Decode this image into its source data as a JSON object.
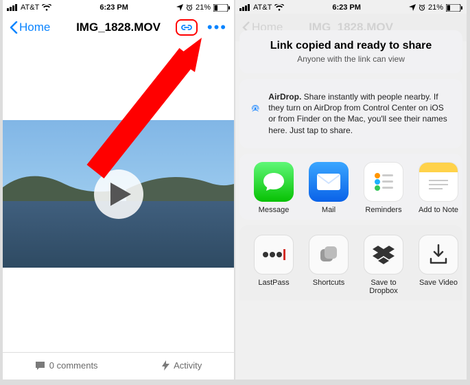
{
  "status": {
    "carrier": "AT&T",
    "time": "6:23 PM",
    "battery": "21%"
  },
  "nav": {
    "back": "Home",
    "title": "IMG_1828.MOV"
  },
  "bottom": {
    "comments": "0 comments",
    "activity": "Activity"
  },
  "share": {
    "header_title": "Link copied and ready to share",
    "header_sub": "Anyone with the link can view",
    "airdrop_bold": "AirDrop.",
    "airdrop_text": " Share instantly with people nearby. If they turn on AirDrop from Control Center on iOS or from Finder on the Mac, you'll see their names here. Just tap to share.",
    "apps": {
      "message": "Message",
      "mail": "Mail",
      "reminders": "Reminders",
      "notes": "Add to Note"
    },
    "actions": {
      "lastpass": "LastPass",
      "shortcuts": "Shortcuts",
      "dropbox": "Save to Dropbox",
      "savevideo": "Save Video"
    }
  }
}
